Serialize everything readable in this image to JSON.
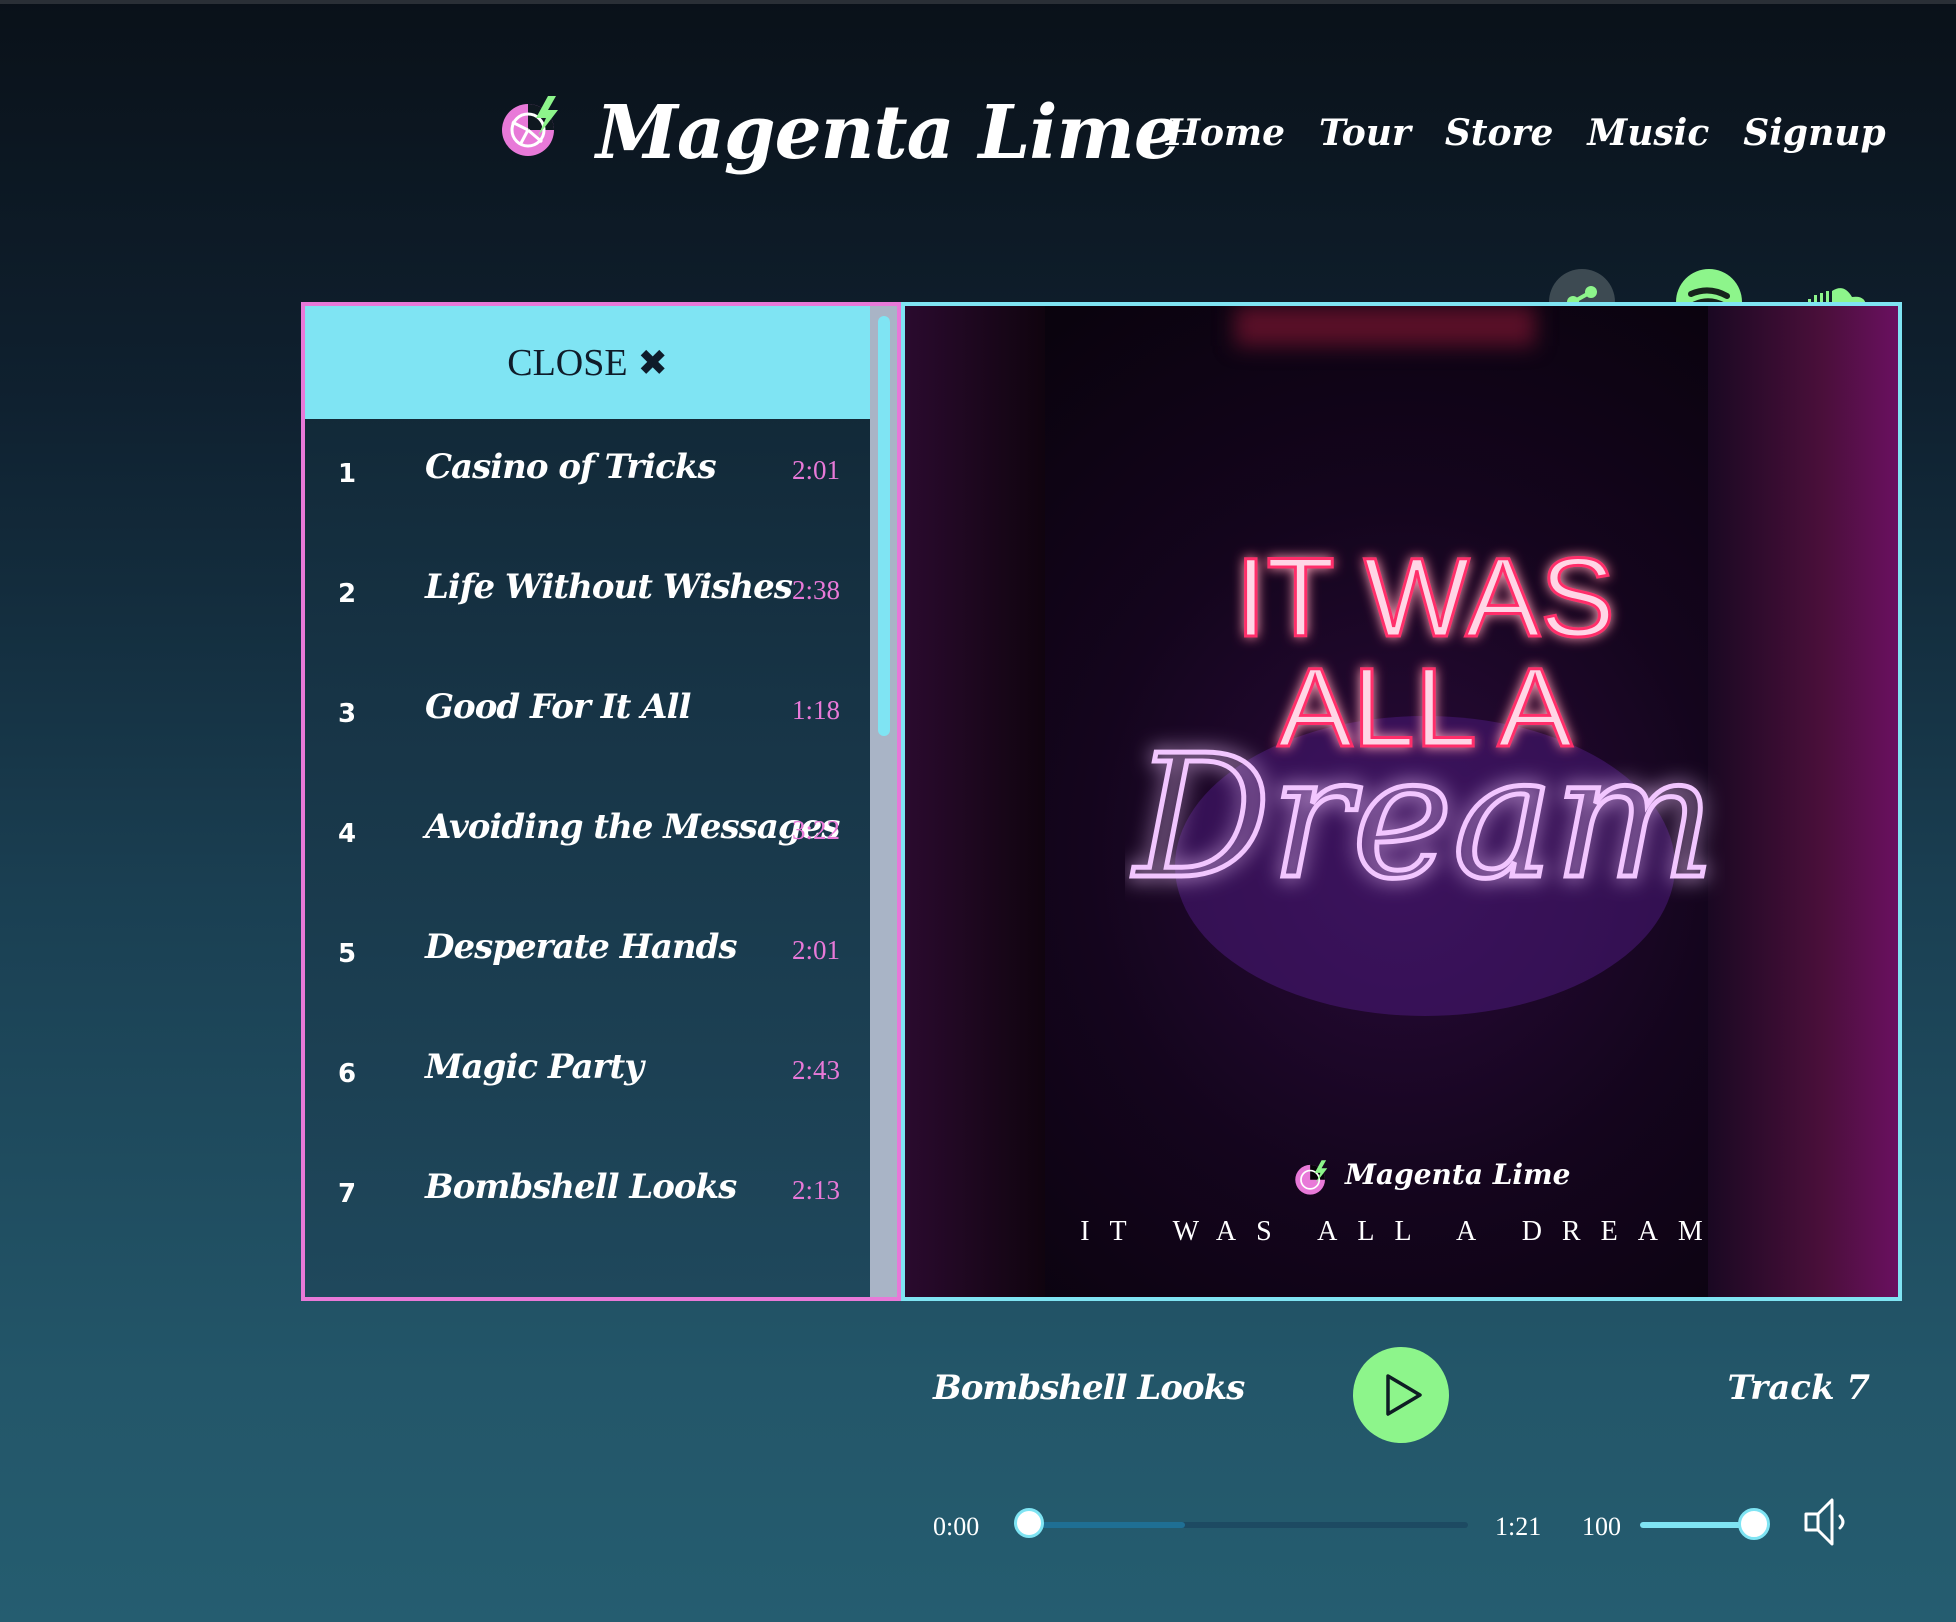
{
  "header": {
    "brand": "Magenta Lime",
    "nav": [
      {
        "label": "Home"
      },
      {
        "label": "Tour"
      },
      {
        "label": "Store"
      },
      {
        "label": "Music"
      },
      {
        "label": "Signup"
      }
    ]
  },
  "playlist": {
    "close_label": "CLOSE",
    "close_icon": "✖",
    "tracks": [
      {
        "num": "1",
        "title": "Casino of Tricks",
        "duration": "2:01"
      },
      {
        "num": "2",
        "title": "Life Without Wishes",
        "duration": "2:38"
      },
      {
        "num": "3",
        "title": "Good For It All",
        "duration": "1:18"
      },
      {
        "num": "4",
        "title": "Avoiding the Messages",
        "duration": "3:22"
      },
      {
        "num": "5",
        "title": "Desperate Hands",
        "duration": "2:01"
      },
      {
        "num": "6",
        "title": "Magic Party",
        "duration": "2:43"
      },
      {
        "num": "7",
        "title": "Bombshell Looks",
        "duration": "2:13"
      }
    ]
  },
  "album": {
    "neon_line1": "IT WAS",
    "neon_line2": "ALL A",
    "neon_script": "Dream",
    "art_brand": "Magenta Lime",
    "art_subtitle": "IT WAS ALL A DREAM"
  },
  "social": {
    "share_icon": "share-icon",
    "spotify_icon": "spotify-icon",
    "soundcloud_icon": "soundcloud-icon"
  },
  "player": {
    "now_playing": "Bombshell Looks",
    "track_label": "Track 7",
    "time_current": "0:00",
    "time_total": "1:21",
    "volume": "100",
    "progress_fraction": 0.0,
    "volume_fraction": 1.0
  },
  "colors": {
    "accent_cyan": "#7fe4f3",
    "accent_magenta": "#e879d8",
    "accent_lime": "#8df58b"
  }
}
